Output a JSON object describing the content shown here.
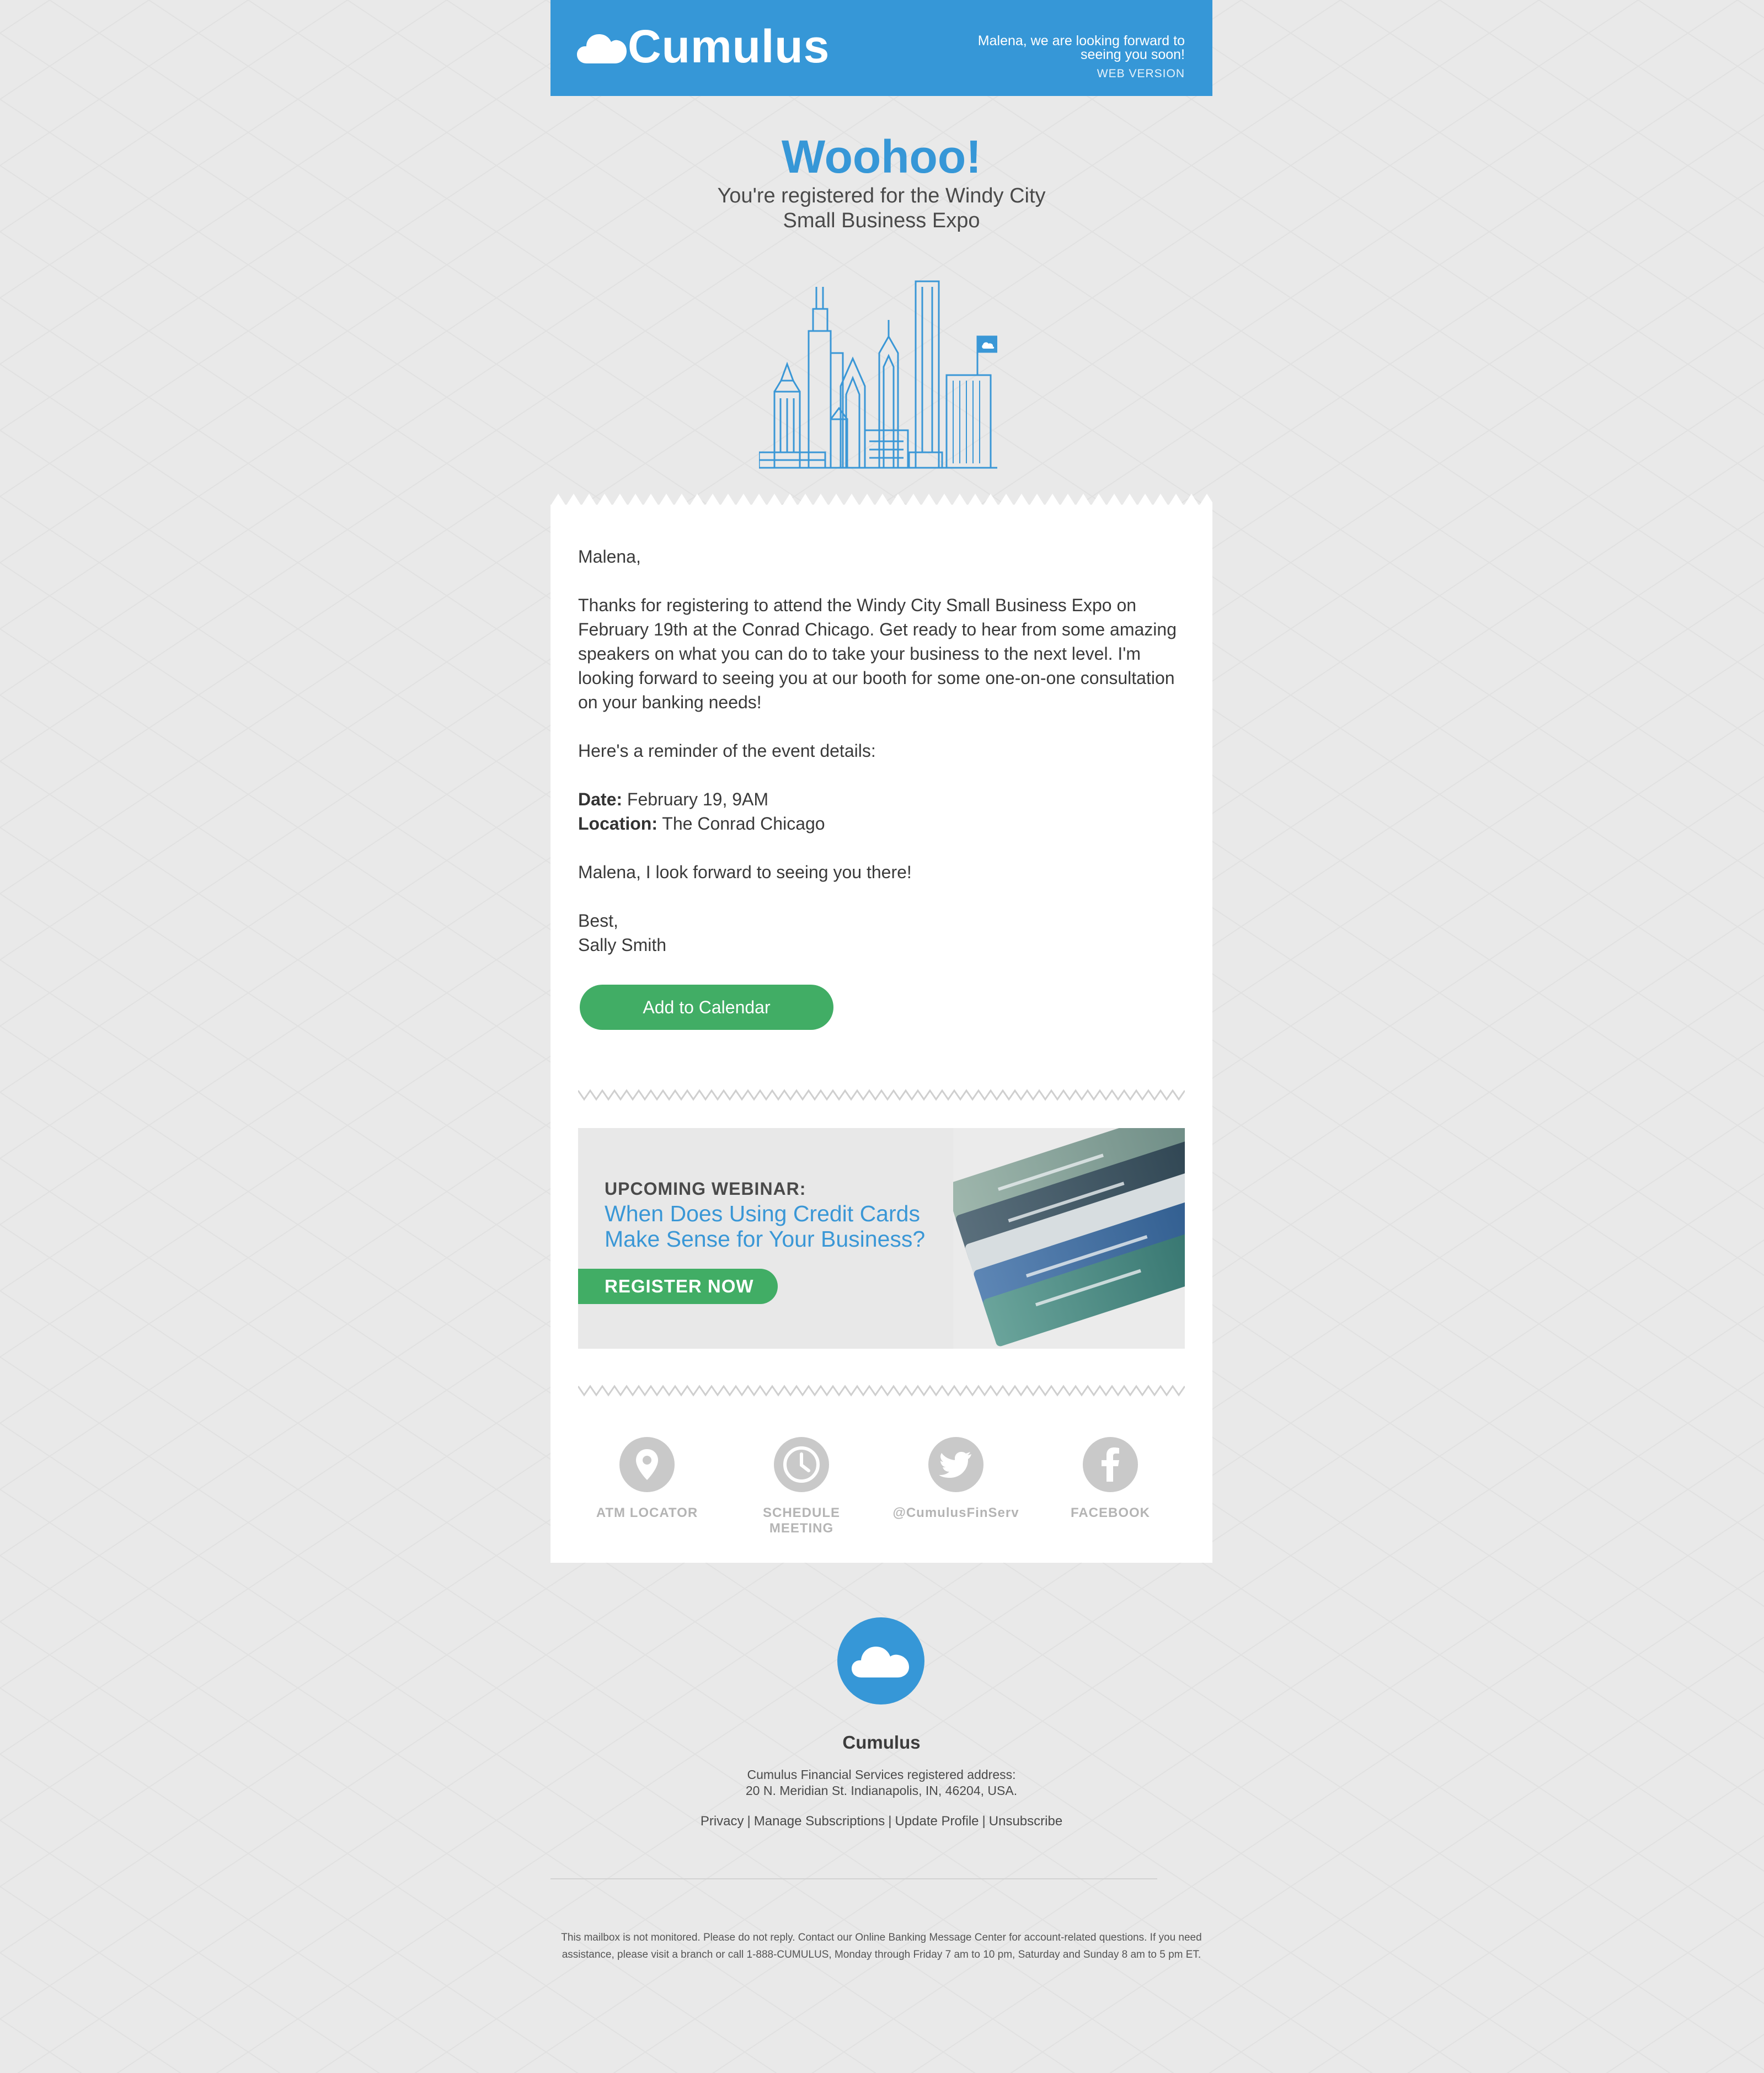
{
  "colors": {
    "brand_blue": "#3697d7",
    "cta_green": "#41ad65",
    "background": "#e9e9e9",
    "icon_gray": "#c9c9c9"
  },
  "header": {
    "brand": "Cumulus",
    "message": "Malena, we are looking forward to seeing you soon!",
    "web_version": "WEB VERSION",
    "logo_icon": "cloud-icon"
  },
  "hero": {
    "title": "Woohoo!",
    "subtitle": "You're registered for the Windy City Small Business Expo",
    "illustration": "city-skyline-icon"
  },
  "letter": {
    "greeting": "Malena,",
    "paragraph": "Thanks for registering to attend the Windy City Small Business Expo on February 19th at the Conrad Chicago. Get ready to hear from some amazing speakers on what you can do to take your business to the next level. I'm looking forward to seeing you at our booth for some one-on-one consultation on your banking needs!",
    "reminder": "Here's a reminder of the event details:",
    "date_label": "Date:",
    "date_value": "February 19, 9AM",
    "location_label": "Location:",
    "location_value": "The Conrad Chicago",
    "closing_line": "Malena, I look forward to seeing you there!",
    "signoff": "Best,",
    "signature": "Sally Smith",
    "calendar_button": "Add to Calendar"
  },
  "webinar": {
    "kicker": "UPCOMING WEBINAR:",
    "title": "When Does Using Credit Cards Make Sense for Your Business?",
    "button": "REGISTER NOW",
    "image": "credit-cards-image"
  },
  "social": [
    {
      "label": "ATM LOCATOR",
      "icon": "map-pin-icon"
    },
    {
      "label": "SCHEDULE MEETING",
      "icon": "clock-icon"
    },
    {
      "label": "@CumulusFinServ",
      "icon": "twitter-icon"
    },
    {
      "label": "FACEBOOK",
      "icon": "facebook-icon"
    }
  ],
  "footer": {
    "brand": "Cumulus",
    "address_line1": "Cumulus Financial Services registered address:",
    "address_line2": "20 N. Meridian St. Indianapolis, IN, 46204, USA.",
    "links": [
      "Privacy",
      "Manage Subscriptions",
      "Update Profile",
      "Unsubscribe"
    ],
    "disclaimer": "This mailbox is not monitored. Please do not reply. Contact our Online Banking Message Center for account-related questions. If you need assistance, please visit a branch or call 1-888-CUMULUS, Monday through Friday 7 am to 10 pm, Saturday and Sunday 8 am to 5 pm ET."
  }
}
